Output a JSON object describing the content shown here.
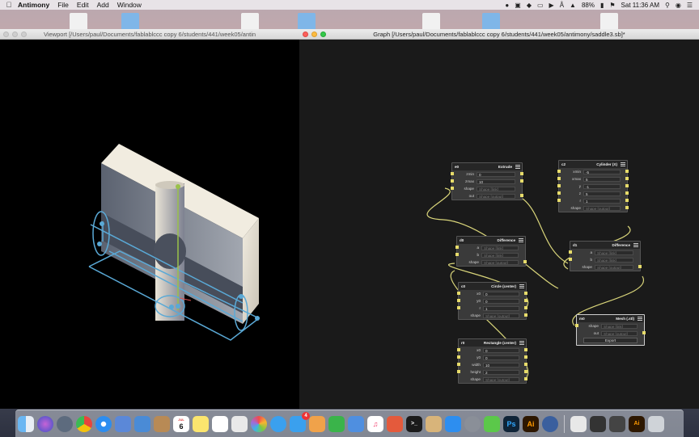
{
  "menubar": {
    "app": "Antimony",
    "menus": [
      "File",
      "Edit",
      "Add",
      "Window"
    ],
    "battery": "88%",
    "clock": "Sat 11:36 AM"
  },
  "viewport": {
    "title": "Viewport [/Users/paul/Documents/fablablccc copy 6/students/441/week05/antin"
  },
  "graph": {
    "title": "Graph [/Users/paul/Documents/fablablccc copy 6/students/441/week05/antimony/saddle3.sb]*",
    "nodes": {
      "e0": {
        "name": "e0",
        "type": "Extrude",
        "rows": [
          {
            "label": "zmin",
            "value": "0"
          },
          {
            "label": "zmax",
            "value": "10"
          },
          {
            "label": "shape",
            "value": "Shape [link]"
          },
          {
            "label": "out",
            "value": "Shape [output]"
          }
        ]
      },
      "c2": {
        "name": "c2",
        "type": "Cylinder (X)",
        "rows": [
          {
            "label": "xmin",
            "value": "-5"
          },
          {
            "label": "xmax",
            "value": "5"
          },
          {
            "label": "y",
            "value": "-1"
          },
          {
            "label": "z",
            "value": "5"
          },
          {
            "label": "r",
            "value": "1"
          },
          {
            "label": "shape",
            "value": "Shape [output]"
          }
        ]
      },
      "d0": {
        "name": "d0",
        "type": "Difference",
        "rows": [
          {
            "label": "a",
            "value": "Shape [link]"
          },
          {
            "label": "b",
            "value": "Shape [link]"
          },
          {
            "label": "shape",
            "value": "Shape [output]"
          }
        ]
      },
      "d1": {
        "name": "d1",
        "type": "Difference",
        "rows": [
          {
            "label": "a",
            "value": "Shape [link]"
          },
          {
            "label": "b",
            "value": "Shape [link]"
          },
          {
            "label": "shape",
            "value": "Shape [output]"
          }
        ]
      },
      "c0": {
        "name": "c0",
        "type": "Circle (center)",
        "rows": [
          {
            "label": "x0",
            "value": "0"
          },
          {
            "label": "y0",
            "value": "0"
          },
          {
            "label": "r",
            "value": "1"
          },
          {
            "label": "shape",
            "value": "Shape [output]"
          }
        ]
      },
      "m0": {
        "name": "m0",
        "type": "Mesh (.stl)",
        "rows": [
          {
            "label": "shape",
            "value": "Shape [link]"
          },
          {
            "label": "out",
            "value": "Shape [output]"
          }
        ],
        "button": "Export"
      },
      "r0": {
        "name": "r0",
        "type": "Rectangle (center)",
        "rows": [
          {
            "label": "x0",
            "value": "0"
          },
          {
            "label": "y0",
            "value": "0"
          },
          {
            "label": "width",
            "value": "10"
          },
          {
            "label": "height",
            "value": "2"
          },
          {
            "label": "shape",
            "value": "Shape [output]"
          }
        ]
      }
    }
  },
  "dock": {
    "calendar_month": "JUL",
    "calendar_day": "6",
    "mail_badge": "4",
    "photoshop": "Ps",
    "illustrator": "Ai"
  },
  "colors": {
    "port": "#e7dc6a",
    "wire": "#d9d57a",
    "handle": "#5aa9d6",
    "model_face": "#e4ded0",
    "model_side": "#8a909c"
  }
}
